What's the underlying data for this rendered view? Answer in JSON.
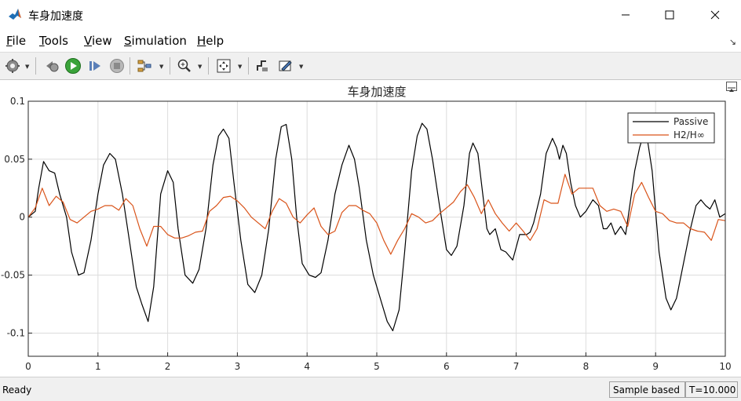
{
  "window": {
    "title": "车身加速度"
  },
  "menu": [
    {
      "label": "File",
      "accel": "F",
      "rest": "ile"
    },
    {
      "label": "Tools",
      "accel": "T",
      "rest": "ools"
    },
    {
      "label": "View",
      "accel": "V",
      "rest": "iew"
    },
    {
      "label": "Simulation",
      "accel": "S",
      "rest": "imulation"
    },
    {
      "label": "Help",
      "accel": "H",
      "rest": "elp"
    }
  ],
  "toolbar": {
    "icons": [
      "settings-icon",
      "step-back-icon",
      "run-icon",
      "step-forward-icon",
      "stop-icon",
      "signal-selector-icon",
      "zoom-in-icon",
      "fit-to-view-icon",
      "cursor-measure-icon",
      "style-icon"
    ]
  },
  "status": {
    "ready": "Ready",
    "sample_based": "Sample based",
    "time": "T=10.000"
  },
  "colors": {
    "passive": "#000000",
    "h2hinf": "#d95319",
    "grid": "#dcdcdc"
  },
  "chart_data": {
    "type": "line",
    "title": "车身加速度",
    "xlabel": "",
    "ylabel": "",
    "xlim": [
      0,
      10
    ],
    "ylim": [
      -0.12,
      0.1
    ],
    "xticks": [
      "0",
      "1",
      "2",
      "3",
      "4",
      "5",
      "6",
      "7",
      "8",
      "9",
      "10"
    ],
    "yticks": [
      "0.1",
      "0.05",
      "0",
      "-0.05",
      "-0.1"
    ],
    "ytick_values": [
      0.1,
      0.05,
      0,
      -0.05,
      -0.1
    ],
    "grid": true,
    "legend": "top-right",
    "series": [
      {
        "name": "Passive",
        "color": "#000000",
        "points": [
          [
            0,
            0
          ],
          [
            0.1,
            0.005
          ],
          [
            0.15,
            0.025
          ],
          [
            0.22,
            0.048
          ],
          [
            0.3,
            0.04
          ],
          [
            0.38,
            0.038
          ],
          [
            0.45,
            0.02
          ],
          [
            0.55,
            0
          ],
          [
            0.62,
            -0.03
          ],
          [
            0.72,
            -0.05
          ],
          [
            0.8,
            -0.048
          ],
          [
            0.9,
            -0.02
          ],
          [
            1.0,
            0.02
          ],
          [
            1.08,
            0.045
          ],
          [
            1.17,
            0.055
          ],
          [
            1.25,
            0.05
          ],
          [
            1.35,
            0.02
          ],
          [
            1.45,
            -0.02
          ],
          [
            1.55,
            -0.06
          ],
          [
            1.63,
            -0.075
          ],
          [
            1.72,
            -0.09
          ],
          [
            1.8,
            -0.06
          ],
          [
            1.9,
            0.02
          ],
          [
            2.0,
            0.04
          ],
          [
            2.08,
            0.03
          ],
          [
            2.15,
            -0.01
          ],
          [
            2.25,
            -0.05
          ],
          [
            2.36,
            -0.057
          ],
          [
            2.45,
            -0.045
          ],
          [
            2.55,
            -0.01
          ],
          [
            2.65,
            0.045
          ],
          [
            2.73,
            0.07
          ],
          [
            2.8,
            0.076
          ],
          [
            2.88,
            0.068
          ],
          [
            2.95,
            0.03
          ],
          [
            3.05,
            -0.02
          ],
          [
            3.15,
            -0.058
          ],
          [
            3.25,
            -0.065
          ],
          [
            3.35,
            -0.05
          ],
          [
            3.45,
            -0.01
          ],
          [
            3.55,
            0.05
          ],
          [
            3.63,
            0.078
          ],
          [
            3.7,
            0.08
          ],
          [
            3.78,
            0.05
          ],
          [
            3.85,
            0
          ],
          [
            3.93,
            -0.04
          ],
          [
            4.03,
            -0.05
          ],
          [
            4.12,
            -0.052
          ],
          [
            4.2,
            -0.048
          ],
          [
            4.3,
            -0.02
          ],
          [
            4.4,
            0.02
          ],
          [
            4.5,
            0.045
          ],
          [
            4.6,
            0.062
          ],
          [
            4.68,
            0.05
          ],
          [
            4.75,
            0.025
          ],
          [
            4.85,
            -0.02
          ],
          [
            4.95,
            -0.05
          ],
          [
            5.05,
            -0.07
          ],
          [
            5.15,
            -0.09
          ],
          [
            5.23,
            -0.098
          ],
          [
            5.32,
            -0.08
          ],
          [
            5.4,
            -0.03
          ],
          [
            5.5,
            0.04
          ],
          [
            5.58,
            0.07
          ],
          [
            5.65,
            0.081
          ],
          [
            5.72,
            0.076
          ],
          [
            5.8,
            0.05
          ],
          [
            5.9,
            0.01
          ],
          [
            6.0,
            -0.028
          ],
          [
            6.07,
            -0.033
          ],
          [
            6.15,
            -0.025
          ],
          [
            6.25,
            0.01
          ],
          [
            6.33,
            0.055
          ],
          [
            6.38,
            0.064
          ],
          [
            6.45,
            0.055
          ],
          [
            6.52,
            0.02
          ],
          [
            6.58,
            -0.01
          ],
          [
            6.62,
            -0.015
          ],
          [
            6.7,
            -0.01
          ],
          [
            6.78,
            -0.028
          ],
          [
            6.85,
            -0.03
          ],
          [
            6.95,
            -0.037
          ],
          [
            7.05,
            -0.015
          ],
          [
            7.15,
            -0.015
          ],
          [
            7.2,
            -0.013
          ],
          [
            7.25,
            -0.005
          ],
          [
            7.35,
            0.02
          ],
          [
            7.43,
            0.055
          ],
          [
            7.52,
            0.068
          ],
          [
            7.58,
            0.06
          ],
          [
            7.62,
            0.05
          ],
          [
            7.67,
            0.062
          ],
          [
            7.72,
            0.055
          ],
          [
            7.78,
            0.03
          ],
          [
            7.85,
            0.01
          ],
          [
            7.92,
            0
          ],
          [
            8.0,
            0.005
          ],
          [
            8.1,
            0.015
          ],
          [
            8.18,
            0.01
          ],
          [
            8.25,
            -0.01
          ],
          [
            8.3,
            -0.01
          ],
          [
            8.36,
            -0.005
          ],
          [
            8.42,
            -0.015
          ],
          [
            8.5,
            -0.008
          ],
          [
            8.57,
            -0.015
          ],
          [
            8.63,
            0.01
          ],
          [
            8.7,
            0.04
          ],
          [
            8.77,
            0.06
          ],
          [
            8.83,
            0.072
          ],
          [
            8.88,
            0.068
          ],
          [
            8.95,
            0.04
          ],
          [
            9.05,
            -0.03
          ],
          [
            9.15,
            -0.07
          ],
          [
            9.22,
            -0.08
          ],
          [
            9.3,
            -0.07
          ],
          [
            9.4,
            -0.04
          ],
          [
            9.5,
            -0.01
          ],
          [
            9.58,
            0.01
          ],
          [
            9.65,
            0.015
          ],
          [
            9.72,
            0.01
          ],
          [
            9.78,
            0.007
          ],
          [
            9.85,
            0.015
          ],
          [
            9.92,
            0
          ],
          [
            10.0,
            0.003
          ]
        ]
      },
      {
        "name": "H2/H∞",
        "color": "#d95319",
        "points": [
          [
            0,
            0
          ],
          [
            0.1,
            0.008
          ],
          [
            0.2,
            0.025
          ],
          [
            0.3,
            0.01
          ],
          [
            0.4,
            0.018
          ],
          [
            0.5,
            0.013
          ],
          [
            0.6,
            -0.002
          ],
          [
            0.7,
            -0.005
          ],
          [
            0.8,
            0
          ],
          [
            0.9,
            0.005
          ],
          [
            1.0,
            0.007
          ],
          [
            1.1,
            0.01
          ],
          [
            1.2,
            0.01
          ],
          [
            1.3,
            0.006
          ],
          [
            1.4,
            0.016
          ],
          [
            1.5,
            0.01
          ],
          [
            1.6,
            -0.01
          ],
          [
            1.7,
            -0.025
          ],
          [
            1.8,
            -0.008
          ],
          [
            1.9,
            -0.008
          ],
          [
            2.0,
            -0.015
          ],
          [
            2.1,
            -0.018
          ],
          [
            2.2,
            -0.018
          ],
          [
            2.3,
            -0.016
          ],
          [
            2.4,
            -0.013
          ],
          [
            2.5,
            -0.012
          ],
          [
            2.6,
            0.005
          ],
          [
            2.7,
            0.01
          ],
          [
            2.8,
            0.017
          ],
          [
            2.9,
            0.018
          ],
          [
            3.0,
            0.014
          ],
          [
            3.1,
            0.008
          ],
          [
            3.2,
            0
          ],
          [
            3.3,
            -0.005
          ],
          [
            3.4,
            -0.01
          ],
          [
            3.5,
            0.005
          ],
          [
            3.6,
            0.016
          ],
          [
            3.7,
            0.012
          ],
          [
            3.8,
            0
          ],
          [
            3.9,
            -0.005
          ],
          [
            4.0,
            0.002
          ],
          [
            4.1,
            0.008
          ],
          [
            4.2,
            -0.008
          ],
          [
            4.3,
            -0.015
          ],
          [
            4.4,
            -0.012
          ],
          [
            4.5,
            0.004
          ],
          [
            4.6,
            0.01
          ],
          [
            4.7,
            0.01
          ],
          [
            4.8,
            0.006
          ],
          [
            4.9,
            0.003
          ],
          [
            5.0,
            -0.005
          ],
          [
            5.1,
            -0.02
          ],
          [
            5.2,
            -0.032
          ],
          [
            5.3,
            -0.02
          ],
          [
            5.4,
            -0.01
          ],
          [
            5.5,
            0.003
          ],
          [
            5.6,
            0
          ],
          [
            5.7,
            -0.005
          ],
          [
            5.8,
            -0.003
          ],
          [
            5.9,
            0.003
          ],
          [
            6.0,
            0.008
          ],
          [
            6.1,
            0.013
          ],
          [
            6.2,
            0.022
          ],
          [
            6.3,
            0.028
          ],
          [
            6.4,
            0.017
          ],
          [
            6.5,
            0.003
          ],
          [
            6.6,
            0.015
          ],
          [
            6.7,
            0.003
          ],
          [
            6.8,
            -0.005
          ],
          [
            6.9,
            -0.012
          ],
          [
            7.0,
            -0.005
          ],
          [
            7.1,
            -0.012
          ],
          [
            7.2,
            -0.02
          ],
          [
            7.3,
            -0.01
          ],
          [
            7.4,
            0.015
          ],
          [
            7.5,
            0.012
          ],
          [
            7.6,
            0.012
          ],
          [
            7.7,
            0.037
          ],
          [
            7.8,
            0.02
          ],
          [
            7.9,
            0.025
          ],
          [
            8.0,
            0.025
          ],
          [
            8.1,
            0.025
          ],
          [
            8.2,
            0.01
          ],
          [
            8.3,
            0.005
          ],
          [
            8.4,
            0.007
          ],
          [
            8.5,
            0.005
          ],
          [
            8.6,
            -0.008
          ],
          [
            8.7,
            0.02
          ],
          [
            8.8,
            0.03
          ],
          [
            8.9,
            0.017
          ],
          [
            9.0,
            0.005
          ],
          [
            9.1,
            0.003
          ],
          [
            9.2,
            -0.003
          ],
          [
            9.3,
            -0.005
          ],
          [
            9.4,
            -0.005
          ],
          [
            9.5,
            -0.01
          ],
          [
            9.6,
            -0.012
          ],
          [
            9.7,
            -0.013
          ],
          [
            9.8,
            -0.02
          ],
          [
            9.9,
            -0.002
          ],
          [
            10.0,
            -0.003
          ]
        ]
      }
    ]
  }
}
